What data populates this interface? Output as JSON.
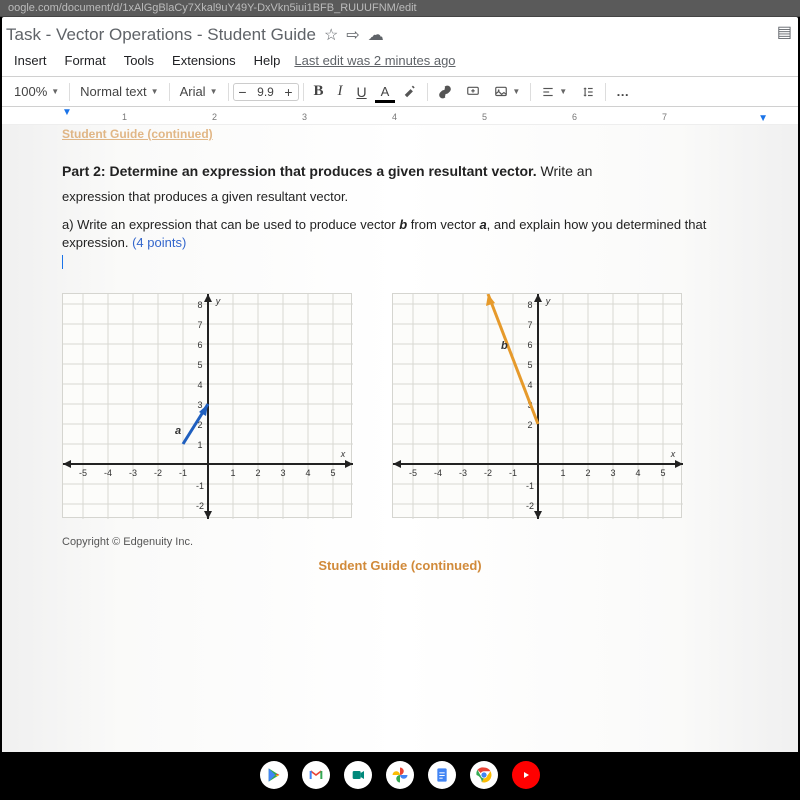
{
  "browser": {
    "url_fragment": "oogle.com/document/d/1xAlGgBlaCy7Xkal9uY49Y-DxVkn5iui1BFB_RUUUFNM/edit"
  },
  "header": {
    "title": "Task - Vector Operations - Student Guide",
    "star_icon": "☆",
    "move_icon": "⇨",
    "cloud_icon": "☁"
  },
  "menu": {
    "items": [
      "Insert",
      "Format",
      "Tools",
      "Extensions",
      "Help"
    ],
    "last_edit": "Last edit was 2 minutes ago"
  },
  "toolbar": {
    "zoom": "100%",
    "style": "Normal text",
    "font": "Arial",
    "font_size": "9.9",
    "minus": "−",
    "plus": "+",
    "bold": "B",
    "italic": "I",
    "underline": "U",
    "text_color": "A",
    "link_icon": "🔗",
    "comment_icon": "⊞",
    "image_icon": "🖼",
    "align_icon": "≡",
    "line_icon": "⇵",
    "list_icon": "≣",
    "more": "…"
  },
  "ruler": {
    "ticks": [
      "1",
      "2",
      "3",
      "4",
      "5",
      "6",
      "7"
    ]
  },
  "doc": {
    "header_cont": "Student Guide (continued)",
    "part_bold": "Part 2: Determine an expression that produces a given resultant vector.",
    "part_tail": " Write an",
    "sub": "expression that produces a given resultant vector.",
    "q_a_1": "a) Write an expression that can be used to produce vector ",
    "q_a_b": "b",
    "q_a_2": " from vector ",
    "q_a_a": "a",
    "q_a_3": ", and explain how you determined that expression. ",
    "points": "(4 points)",
    "copyright": "Copyright © Edgenuity Inc.",
    "footer_cont": "Student Guide (continued)"
  },
  "chart_data": [
    {
      "type": "vector-plot",
      "title": "",
      "xlabel": "x",
      "ylabel": "y",
      "xlim": [
        -5,
        5
      ],
      "ylim": [
        -2,
        8
      ],
      "vectors": [
        {
          "name": "a",
          "from": [
            -1,
            1
          ],
          "to": [
            0,
            3
          ],
          "color": "#1f5fbf"
        }
      ]
    },
    {
      "type": "vector-plot",
      "title": "",
      "xlabel": "x",
      "ylabel": "y",
      "xlim": [
        -5,
        5
      ],
      "ylim": [
        -2,
        8
      ],
      "vectors": [
        {
          "name": "b",
          "from": [
            0,
            2
          ],
          "to": [
            -2,
            8
          ],
          "color": "#e69a2b"
        }
      ]
    }
  ],
  "tb_icons": {
    "play": "▶",
    "gmail": "M",
    "meet": "📷",
    "photos": "✦",
    "docs": "≡",
    "chrome": "◉",
    "yt": "▶"
  }
}
